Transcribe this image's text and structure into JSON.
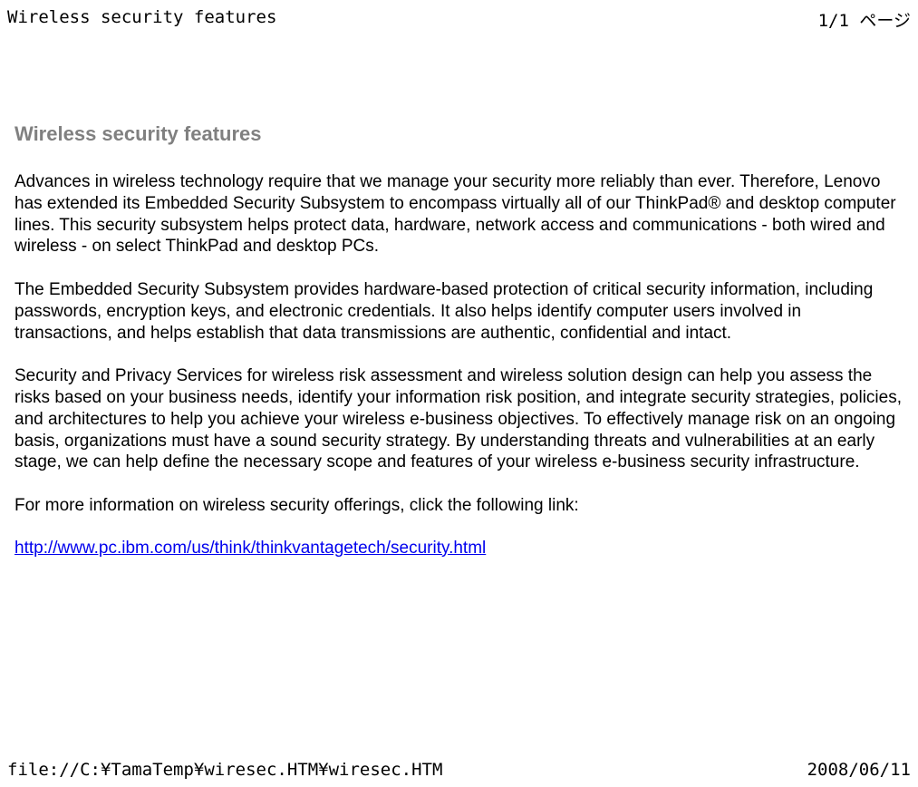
{
  "header": {
    "title": "Wireless security features",
    "page_label": "1/1 ページ"
  },
  "footer": {
    "path": "file://C:¥TamaTemp¥wiresec.HTM¥wiresec.HTM",
    "date": "2008/06/11"
  },
  "document": {
    "title": "Wireless security features",
    "para1": "Advances in wireless technology require that we manage your security more reliably than ever. Therefore, Lenovo has extended its Embedded Security Subsystem to encompass virtually all of our ThinkPad® and desktop computer lines. This security subsystem helps protect data, hardware, network access and communications - both wired and wireless - on select ThinkPad and desktop PCs.",
    "para2": "The Embedded Security Subsystem provides hardware-based protection of critical security information, including passwords, encryption keys, and electronic credentials. It also helps identify computer users involved in transactions, and helps establish that data transmissions are authentic, confidential and intact.",
    "para3": "Security and Privacy Services for wireless risk assessment and wireless solution design can help you assess the risks based on your business needs, identify your information risk position, and integrate security strategies, policies, and architectures to help you achieve your wireless e-business objectives. To effectively manage risk on an ongoing basis, organizations must have a sound security strategy. By understanding threats and vulnerabilities at an early stage, we can help define the necessary scope and features of your wireless e-business security infrastructure.",
    "para4": "For more information on wireless security offerings, click the following link:",
    "link_text": "http://www.pc.ibm.com/us/think/thinkvantagetech/security.html"
  }
}
